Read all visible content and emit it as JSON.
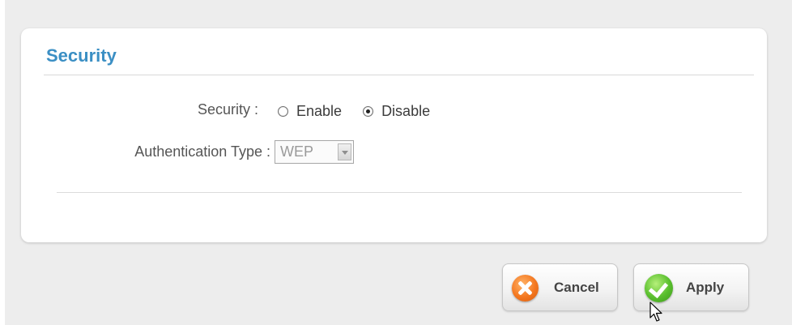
{
  "panel": {
    "title": "Security"
  },
  "form": {
    "security_label": "Security :",
    "security_options": [
      {
        "label": "Enable",
        "checked": false
      },
      {
        "label": "Disable",
        "checked": true
      }
    ],
    "auth_type_label": "Authentication Type :",
    "auth_type_value": "WEP"
  },
  "buttons": {
    "cancel_label": "Cancel",
    "apply_label": "Apply"
  },
  "icons": {
    "cancel": "x-circle-icon",
    "apply": "checkmark-circle-icon",
    "cursor": "mouse-pointer-icon"
  },
  "colors": {
    "title": "#3b8fc4",
    "cancel_icon": "#f4771f",
    "apply_icon": "#58be2d",
    "background": "#ededed"
  }
}
